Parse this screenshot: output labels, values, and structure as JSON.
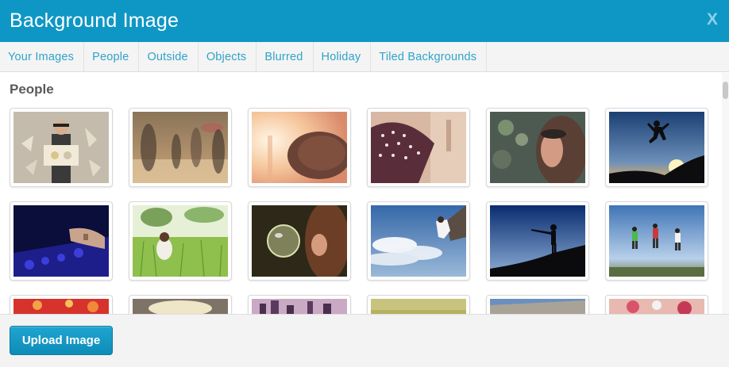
{
  "dialog": {
    "title": "Background Image",
    "close_label": "X"
  },
  "tabs": [
    {
      "label": "Your Images"
    },
    {
      "label": "People"
    },
    {
      "label": "Outside"
    },
    {
      "label": "Objects"
    },
    {
      "label": "Blurred"
    },
    {
      "label": "Holiday"
    },
    {
      "label": "Tiled Backgrounds"
    }
  ],
  "section": {
    "title": "People"
  },
  "images": [
    {
      "description": "man-holding-sign-with-flowers"
    },
    {
      "description": "blurred-city-crowd"
    },
    {
      "description": "woman-in-sun-hat-backlit"
    },
    {
      "description": "polka-dot-hat-sunset"
    },
    {
      "description": "woman-with-sunglasses-closeup"
    },
    {
      "description": "person-jumping-at-sunset"
    },
    {
      "description": "dj-hands-on-mixer"
    },
    {
      "description": "woman-sitting-in-grass"
    },
    {
      "description": "girl-with-soap-bubble"
    },
    {
      "description": "climber-on-rock-blue-sky"
    },
    {
      "description": "silhouette-pointing-on-rock"
    },
    {
      "description": "group-jumping-on-hill"
    },
    {
      "description": "red-bokeh-lights"
    },
    {
      "description": "sun-glow-sky"
    },
    {
      "description": "city-skyline-dusk"
    },
    {
      "description": "yellow-green-field"
    },
    {
      "description": "stone-bridge-railing"
    },
    {
      "description": "pink-flowers"
    }
  ],
  "footer": {
    "upload_label": "Upload Image"
  },
  "colors": {
    "header_bg": "#0e97c5",
    "tab_text": "#2fa3c8",
    "button_bg": "#1497c3"
  }
}
